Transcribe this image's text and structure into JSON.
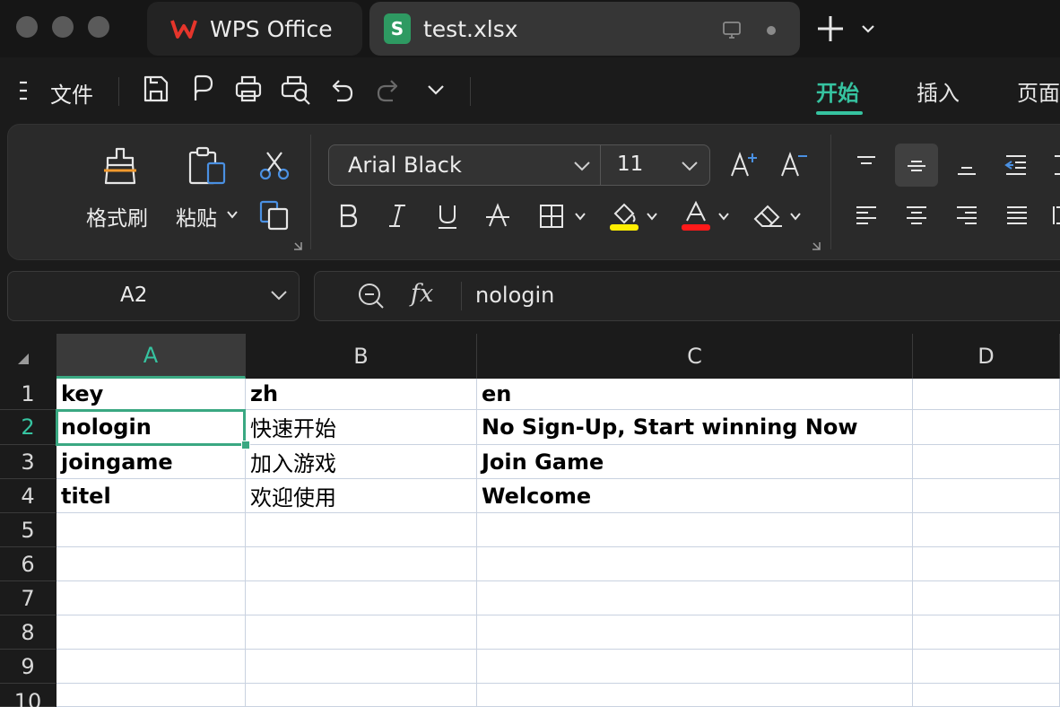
{
  "tabs": [
    {
      "label": "WPS Office",
      "icon": "wps-logo-icon"
    },
    {
      "label": "test.xlsx",
      "icon": "spreadsheet-s-icon",
      "logo_letter": "S"
    }
  ],
  "menu": {
    "file_label": "文件",
    "ribbon_tabs": [
      "开始",
      "插入",
      "页面"
    ],
    "active_tab": "开始"
  },
  "ribbon": {
    "format_painter_label": "格式刷",
    "paste_label": "粘贴",
    "font_name": "Arial Black",
    "font_size": "11",
    "highlight_color": "#ffee00",
    "font_color": "#ff1a1a"
  },
  "namebox": {
    "value": "A2"
  },
  "formula": {
    "value": "nologin",
    "fx_label": "fx"
  },
  "sheet": {
    "columns": [
      "A",
      "B",
      "C",
      "D"
    ],
    "rows": [
      "1",
      "2",
      "3",
      "4",
      "5",
      "6",
      "7",
      "8",
      "9",
      "10"
    ],
    "selected_column": "A",
    "selected_row": "2",
    "cells": [
      [
        "key",
        "zh",
        "en",
        ""
      ],
      [
        "nologin",
        "快速开始",
        "No Sign-Up, Start winning Now",
        ""
      ],
      [
        "joingame",
        "加入游戏",
        "Join Game",
        ""
      ],
      [
        "titel",
        "欢迎使用",
        "Welcome",
        ""
      ]
    ]
  },
  "colors": {
    "accent": "#36c3a0",
    "selection": "#3aa882"
  }
}
